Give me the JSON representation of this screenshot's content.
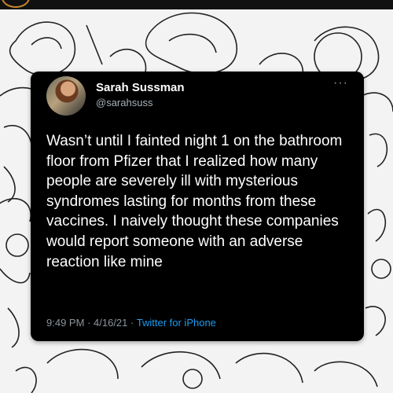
{
  "tweet": {
    "author_name": "Sarah Sussman",
    "author_handle": "@sarahsuss",
    "more_glyph": "···",
    "text": "Wasn’t until I fainted night 1 on the bathroom floor from Pfizer that I realized how many people are severely ill with mysterious syndromes lasting for months from these vaccines. I naively thought these companies would report someone with an adverse reaction like mine",
    "time": "9:49 PM",
    "separator": "·",
    "date": "4/16/21",
    "source": "Twitter for iPhone"
  },
  "colors": {
    "card_bg": "#000000",
    "link": "#1d9bf0",
    "muted": "#8b949c",
    "page_bg": "#f3f3f3"
  }
}
